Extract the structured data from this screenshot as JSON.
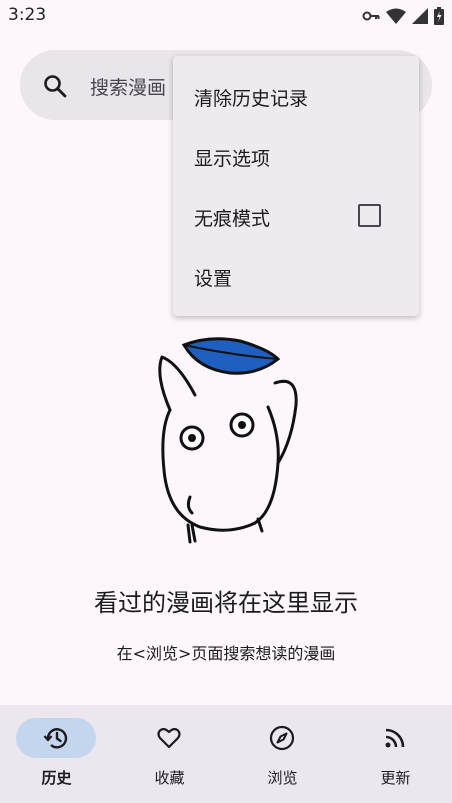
{
  "status_bar": {
    "time": "3:23"
  },
  "search": {
    "placeholder": "搜索漫画"
  },
  "menu": {
    "items": [
      {
        "label": "清除历史记录"
      },
      {
        "label": "显示选项"
      },
      {
        "label": "无痕模式",
        "checked": false
      },
      {
        "label": "设置"
      }
    ]
  },
  "empty_state": {
    "title": "看过的漫画将在这里显示",
    "subtitle": "在<浏览>页面搜索想读的漫画"
  },
  "bottom_nav": {
    "items": [
      {
        "label": "历史",
        "icon": "history-icon",
        "active": true
      },
      {
        "label": "收藏",
        "icon": "heart-icon",
        "active": false
      },
      {
        "label": "浏览",
        "icon": "compass-icon",
        "active": false
      },
      {
        "label": "更新",
        "icon": "rss-icon",
        "active": false
      }
    ]
  },
  "colors": {
    "active_pill": "#c4d6ee",
    "leaf": "#1e5fc0",
    "background": "#fdf7fd"
  }
}
